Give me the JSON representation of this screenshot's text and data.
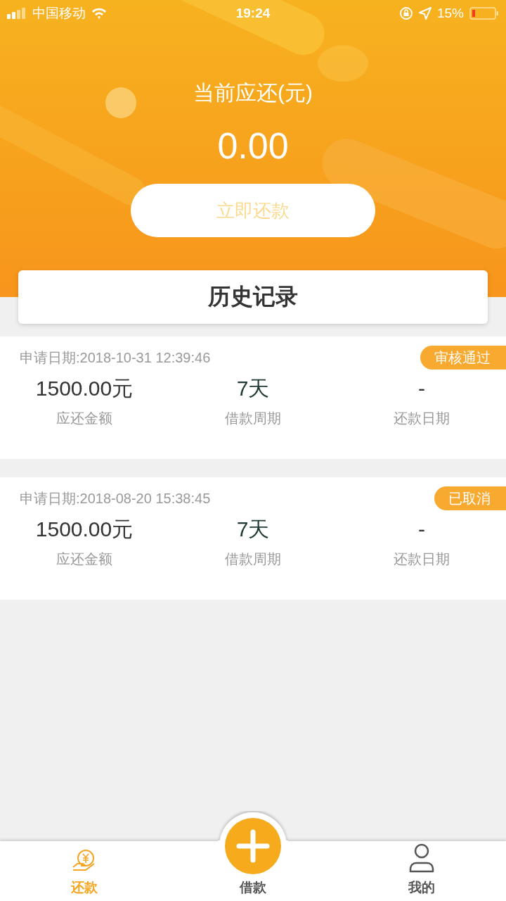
{
  "status_bar": {
    "carrier": "中国移动",
    "time": "19:24",
    "battery": "15%"
  },
  "header": {
    "title": "当前应还(元)",
    "amount": "0.00",
    "button": {
      "label": "立即还款",
      "disabled": true
    }
  },
  "history": {
    "title": "历史记录"
  },
  "records": [
    {
      "date": "申请日期:2018-10-31 12:39:46",
      "status": "审核通过",
      "amount": "1500.00元",
      "amount_label": "应还金额",
      "period": "7天",
      "period_label": "借款周期",
      "repay_date": "-",
      "repay_date_label": "还款日期"
    },
    {
      "date": "申请日期:2018-08-20 15:38:45",
      "status": "已取消",
      "amount": "1500.00元",
      "amount_label": "应还金额",
      "period": "7天",
      "period_label": "借款周期",
      "repay_date": "-",
      "repay_date_label": "还款日期"
    }
  ],
  "tab_bar": {
    "tabs": [
      {
        "label": "还款",
        "kind": "coin",
        "selected": true
      },
      {
        "label": "借款",
        "kind": "center",
        "selected": false
      },
      {
        "label": "我的",
        "kind": "person",
        "selected": false
      }
    ]
  }
}
